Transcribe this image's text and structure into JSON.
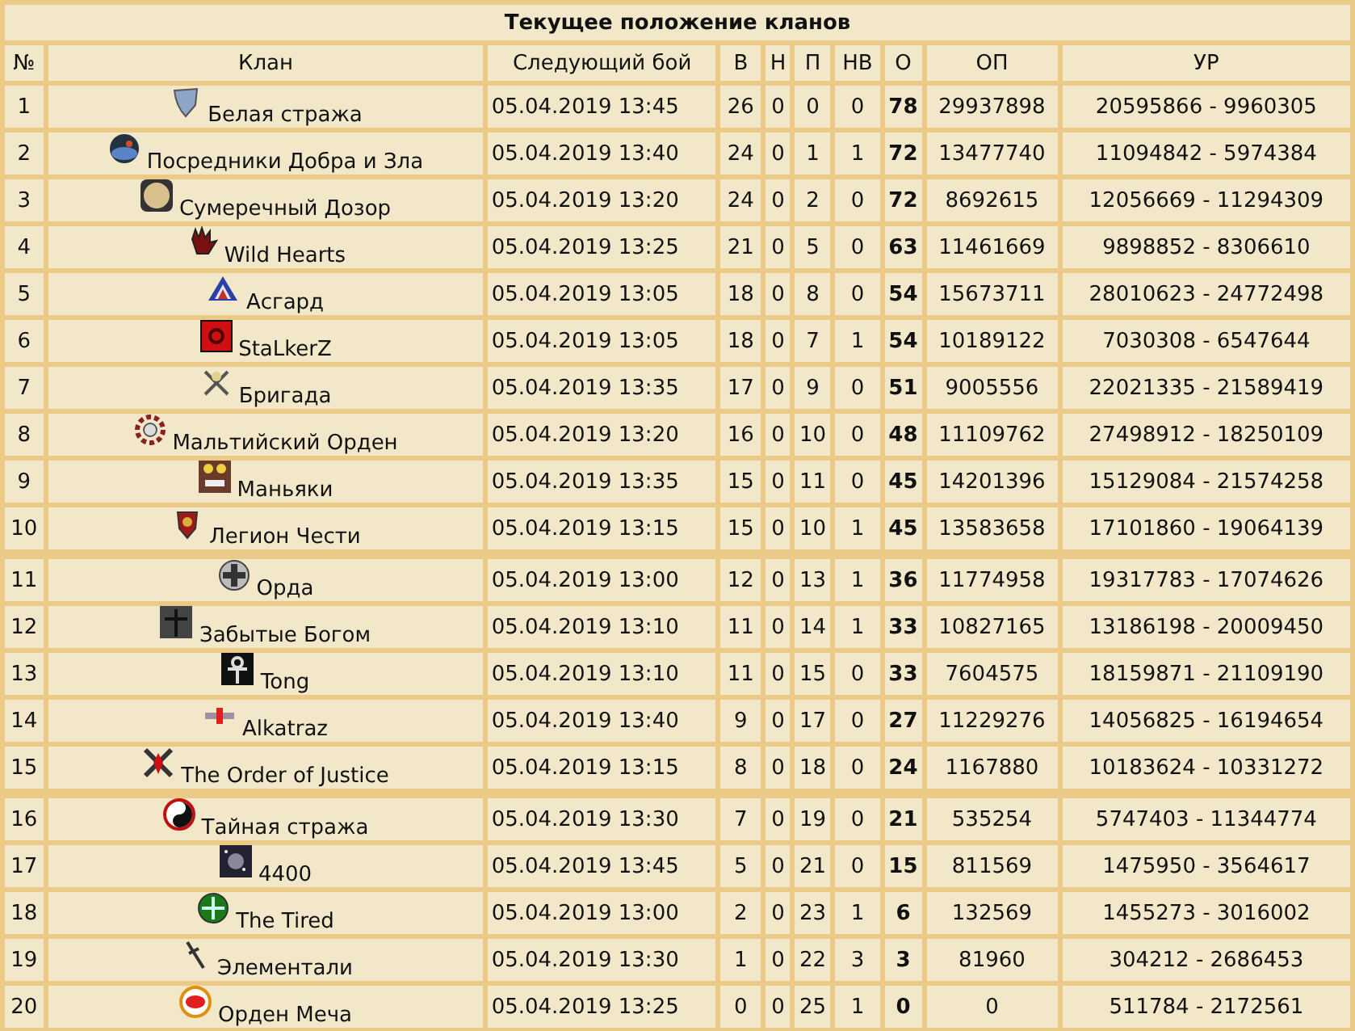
{
  "title": "Текущее положение кланов",
  "columns": [
    "№",
    "Клан",
    "Следующий бой",
    "В",
    "Н",
    "П",
    "НВ",
    "О",
    "ОП",
    "УР"
  ],
  "groups": [
    {
      "rows": [
        {
          "rank": "1",
          "clan": "Белая стража",
          "next": "05.04.2019 13:45",
          "w": "26",
          "d": "0",
          "l": "0",
          "nv": "0",
          "points": "78",
          "op": "29937898",
          "ur": "20595866 - 9960305"
        },
        {
          "rank": "2",
          "clan": "Посредники Добра и Зла",
          "next": "05.04.2019 13:40",
          "w": "24",
          "d": "0",
          "l": "1",
          "nv": "1",
          "points": "72",
          "op": "13477740",
          "ur": "11094842 - 5974384"
        },
        {
          "rank": "3",
          "clan": "Сумеречный Дозор",
          "next": "05.04.2019 13:20",
          "w": "24",
          "d": "0",
          "l": "2",
          "nv": "0",
          "points": "72",
          "op": "8692615",
          "ur": "12056669 - 11294309"
        },
        {
          "rank": "4",
          "clan": "Wild Hearts",
          "next": "05.04.2019 13:25",
          "w": "21",
          "d": "0",
          "l": "5",
          "nv": "0",
          "points": "63",
          "op": "11461669",
          "ur": "9898852 - 8306610"
        },
        {
          "rank": "5",
          "clan": "Асгард",
          "next": "05.04.2019 13:05",
          "w": "18",
          "d": "0",
          "l": "8",
          "nv": "0",
          "points": "54",
          "op": "15673711",
          "ur": "28010623 - 24772498"
        },
        {
          "rank": "6",
          "clan": "StaLkerZ",
          "next": "05.04.2019 13:05",
          "w": "18",
          "d": "0",
          "l": "7",
          "nv": "1",
          "points": "54",
          "op": "10189122",
          "ur": "7030308 - 6547644"
        },
        {
          "rank": "7",
          "clan": "Бригада",
          "next": "05.04.2019 13:35",
          "w": "17",
          "d": "0",
          "l": "9",
          "nv": "0",
          "points": "51",
          "op": "9005556",
          "ur": "22021335 - 21589419"
        },
        {
          "rank": "8",
          "clan": "Мальтийский Орден",
          "next": "05.04.2019 13:20",
          "w": "16",
          "d": "0",
          "l": "10",
          "nv": "0",
          "points": "48",
          "op": "11109762",
          "ur": "27498912 - 18250109"
        },
        {
          "rank": "9",
          "clan": "Маньяки",
          "next": "05.04.2019 13:35",
          "w": "15",
          "d": "0",
          "l": "11",
          "nv": "0",
          "points": "45",
          "op": "14201396",
          "ur": "15129084 - 21574258"
        },
        {
          "rank": "10",
          "clan": "Легион Чести",
          "next": "05.04.2019 13:15",
          "w": "15",
          "d": "0",
          "l": "10",
          "nv": "1",
          "points": "45",
          "op": "13583658",
          "ur": "17101860 - 19064139"
        }
      ]
    },
    {
      "rows": [
        {
          "rank": "11",
          "clan": "Орда",
          "next": "05.04.2019 13:00",
          "w": "12",
          "d": "0",
          "l": "13",
          "nv": "1",
          "points": "36",
          "op": "11774958",
          "ur": "19317783 - 17074626"
        },
        {
          "rank": "12",
          "clan": "Забытые Богом",
          "next": "05.04.2019 13:10",
          "w": "11",
          "d": "0",
          "l": "14",
          "nv": "1",
          "points": "33",
          "op": "10827165",
          "ur": "13186198 - 20009450"
        },
        {
          "rank": "13",
          "clan": "Tong",
          "next": "05.04.2019 13:10",
          "w": "11",
          "d": "0",
          "l": "15",
          "nv": "0",
          "points": "33",
          "op": "7604575",
          "ur": "18159871 - 21109190"
        },
        {
          "rank": "14",
          "clan": "Alkatraz",
          "next": "05.04.2019 13:40",
          "w": "9",
          "d": "0",
          "l": "17",
          "nv": "0",
          "points": "27",
          "op": "11229276",
          "ur": "14056825 - 16194654"
        },
        {
          "rank": "15",
          "clan": "The Order of Justice",
          "next": "05.04.2019 13:15",
          "w": "8",
          "d": "0",
          "l": "18",
          "nv": "0",
          "points": "24",
          "op": "1167880",
          "ur": "10183624 - 10331272"
        }
      ]
    },
    {
      "rows": [
        {
          "rank": "16",
          "clan": "Тайная стража",
          "next": "05.04.2019 13:30",
          "w": "7",
          "d": "0",
          "l": "19",
          "nv": "0",
          "points": "21",
          "op": "535254",
          "ur": "5747403 - 11344774"
        },
        {
          "rank": "17",
          "clan": "4400",
          "next": "05.04.2019 13:45",
          "w": "5",
          "d": "0",
          "l": "21",
          "nv": "0",
          "points": "15",
          "op": "811569",
          "ur": "1475950 - 3564617"
        },
        {
          "rank": "18",
          "clan": "The Tired",
          "next": "05.04.2019 13:00",
          "w": "2",
          "d": "0",
          "l": "23",
          "nv": "1",
          "points": "6",
          "op": "132569",
          "ur": "1455273 - 3016002"
        },
        {
          "rank": "19",
          "clan": "Элементали",
          "next": "05.04.2019 13:30",
          "w": "1",
          "d": "0",
          "l": "22",
          "nv": "3",
          "points": "3",
          "op": "81960",
          "ur": "304212 - 2686453"
        },
        {
          "rank": "20",
          "clan": "Орден Меча",
          "next": "05.04.2019 13:25",
          "w": "0",
          "d": "0",
          "l": "25",
          "nv": "1",
          "points": "0",
          "op": "0",
          "ur": "511784 - 2172561"
        }
      ]
    }
  ]
}
